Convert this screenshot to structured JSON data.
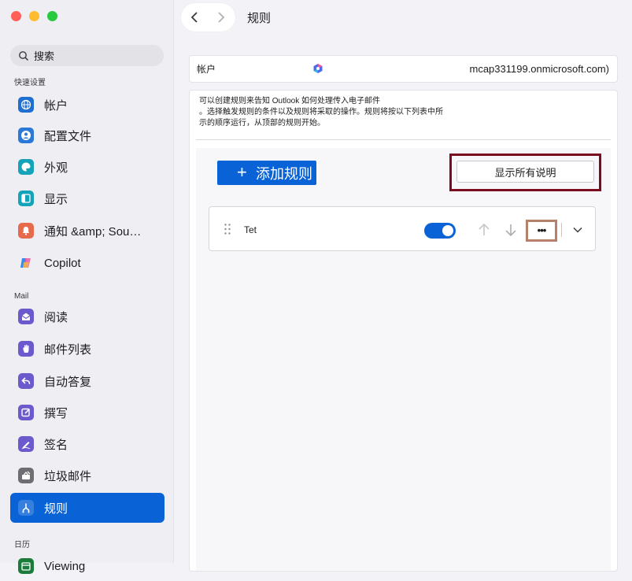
{
  "window": {
    "title": "规则"
  },
  "colors": {
    "accent": "#0a63d6",
    "highlight_frame": "#7a0d20",
    "more_frame": "#b7806a"
  },
  "sidebar": {
    "search_placeholder": "搜索",
    "sections": {
      "quick": "快速设置",
      "mail": "Mail",
      "calendar": "日历"
    },
    "items": [
      {
        "label": "帐户",
        "icon": "globe-icon",
        "color": "#1f6fd1"
      },
      {
        "label": "配置文件",
        "icon": "profile-icon",
        "color": "#2b78d6"
      },
      {
        "label": "外观",
        "icon": "palette-icon",
        "color": "#14a3b8"
      },
      {
        "label": "显示",
        "icon": "display-icon",
        "color": "#14a3b8"
      },
      {
        "label": "通知 &amp; Sou…",
        "icon": "bell-icon",
        "color": "#e66a4c"
      },
      {
        "label": "Copilot",
        "icon": "copilot-icon",
        "color": "#ffffff"
      },
      {
        "label": "阅读",
        "icon": "envelope-open-icon",
        "color": "#6a5acd"
      },
      {
        "label": "邮件列表",
        "icon": "hand-icon",
        "color": "#6a5acd"
      },
      {
        "label": "自动答复",
        "icon": "reply-icon",
        "color": "#6a5acd"
      },
      {
        "label": "撰写",
        "icon": "compose-icon",
        "color": "#6a5acd"
      },
      {
        "label": "签名",
        "icon": "signature-icon",
        "color": "#6a5acd"
      },
      {
        "label": "垃圾邮件",
        "icon": "junk-icon",
        "color": "#6d6d72"
      },
      {
        "label": "规则",
        "icon": "rules-icon",
        "color": "#ffffff",
        "active": true
      },
      {
        "label": "Viewing",
        "icon": "calendar-icon",
        "color": "#1b7b3a"
      }
    ]
  },
  "account": {
    "label": "帐户",
    "email": "mcap331199.onmicrosoft.com)"
  },
  "rules": {
    "description_lines": [
      "可以创建规则来告知 Outlook 如何处理传入电子邮件",
      "。选择触发规则的条件以及规则将采取的操作。规则将按以下列表中所",
      "示的顺序运行，从顶部的规则开始。"
    ],
    "add_button": "添加规则",
    "show_all_button": "显示所有说明",
    "items": [
      {
        "name": "Tet",
        "enabled": true
      }
    ],
    "more_label": "•••"
  }
}
